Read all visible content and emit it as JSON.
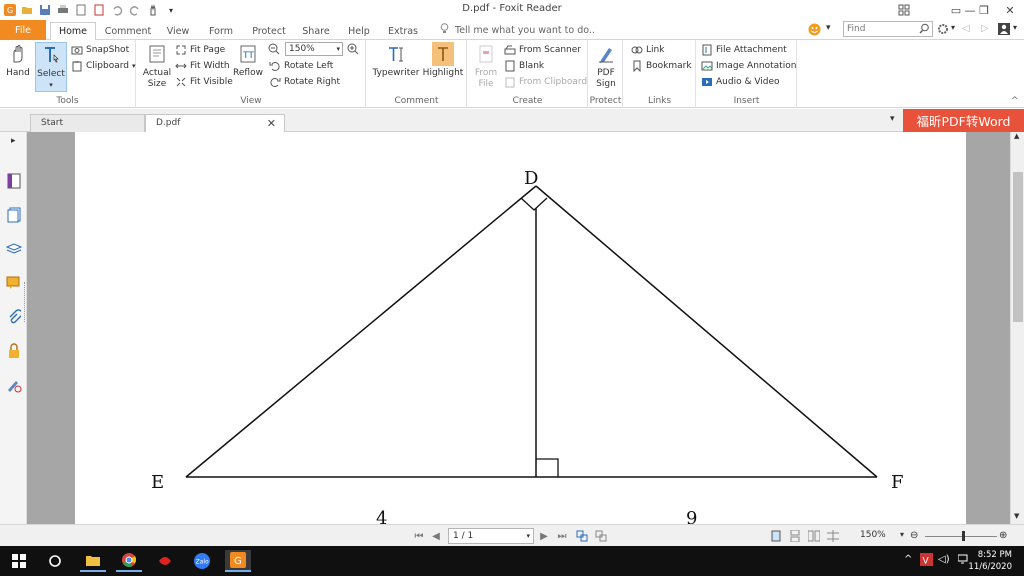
{
  "window": {
    "title": "D.pdf - Foxit Reader",
    "controls": {
      "restore": "▭",
      "minimize": "—",
      "maximize": "❐",
      "close": "✕"
    }
  },
  "ribbon_tabs": {
    "file": "File",
    "items": [
      "Home",
      "Comment",
      "View",
      "Form",
      "Protect",
      "Share",
      "Help",
      "Extras"
    ],
    "tell_me": "Tell me what you want to do..",
    "find_placeholder": "Find"
  },
  "ribbon": {
    "tools": {
      "label": "Tools",
      "hand": "Hand",
      "select": "Select",
      "snapshot": "SnapShot",
      "clipboard": "Clipboard"
    },
    "view": {
      "label": "View",
      "actual_size_1": "Actual",
      "actual_size_2": "Size",
      "fit_page": "Fit Page",
      "fit_width": "Fit Width",
      "fit_visible": "Fit Visible",
      "reflow": "Reflow",
      "zoom_value": "150%",
      "rotate_left": "Rotate Left",
      "rotate_right": "Rotate Right"
    },
    "comment": {
      "label": "Comment",
      "typewriter": "Typewriter",
      "highlight": "Highlight"
    },
    "create": {
      "label": "Create",
      "from_file_1": "From",
      "from_file_2": "File",
      "from_scanner": "From Scanner",
      "blank": "Blank",
      "from_clipboard": "From Clipboard"
    },
    "protect": {
      "label": "Protect",
      "pdf_sign_1": "PDF",
      "pdf_sign_2": "Sign"
    },
    "links": {
      "label": "Links",
      "link": "Link",
      "bookmark": "Bookmark"
    },
    "insert": {
      "label": "Insert",
      "file_attachment": "File Attachment",
      "image_annotation": "Image Annotation",
      "audio_video": "Audio & Video"
    }
  },
  "doc_tabs": {
    "start": "Start",
    "current": "D.pdf",
    "close": "✕"
  },
  "promo": "福昕PDF转Word",
  "figure": {
    "label_d": "D",
    "label_e": "E",
    "label_f": "F",
    "segment_left": "4",
    "segment_right": "9"
  },
  "statusbar": {
    "page": "1 / 1",
    "zoom": "150%"
  },
  "taskbar": {
    "time": "8:52 PM",
    "date": "11/6/2020",
    "zalo": "Zalo"
  }
}
